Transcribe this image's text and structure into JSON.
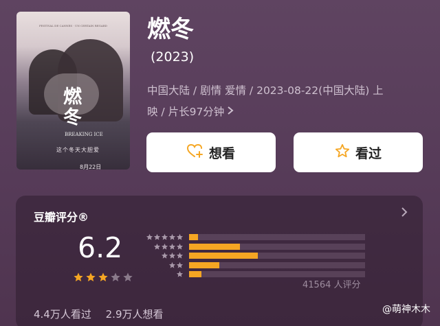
{
  "movie": {
    "title": "燃冬",
    "year": "(2023)",
    "meta_line1": "中国大陆 / 剧情 爱情 / 2023-08-22(中国大陆) 上",
    "meta_line2": "映 / 片长97分钟",
    "poster": {
      "festival_text": "FESTIVAL DE CANNES · UN CERTAIN REGARD",
      "title": "燃冬",
      "subtitle": "BREAKING ICE",
      "tagline": "这个冬天大胆爱",
      "date": "8月22日"
    }
  },
  "actions": {
    "want_label": "想看",
    "seen_label": "看过"
  },
  "rating": {
    "header": "豆瓣评分®",
    "score": "6.2",
    "stars_filled": 3,
    "stars_total": 5,
    "distribution_percent": [
      5,
      29,
      39,
      17,
      7
    ],
    "count_label": "41564 人评分",
    "watched_label": "4.4万人看过",
    "wish_label": "2.9万人想看"
  },
  "watermark": "@萌神木木",
  "colors": {
    "accent_orange": "#f5a623",
    "background": "#5b3f5b"
  }
}
